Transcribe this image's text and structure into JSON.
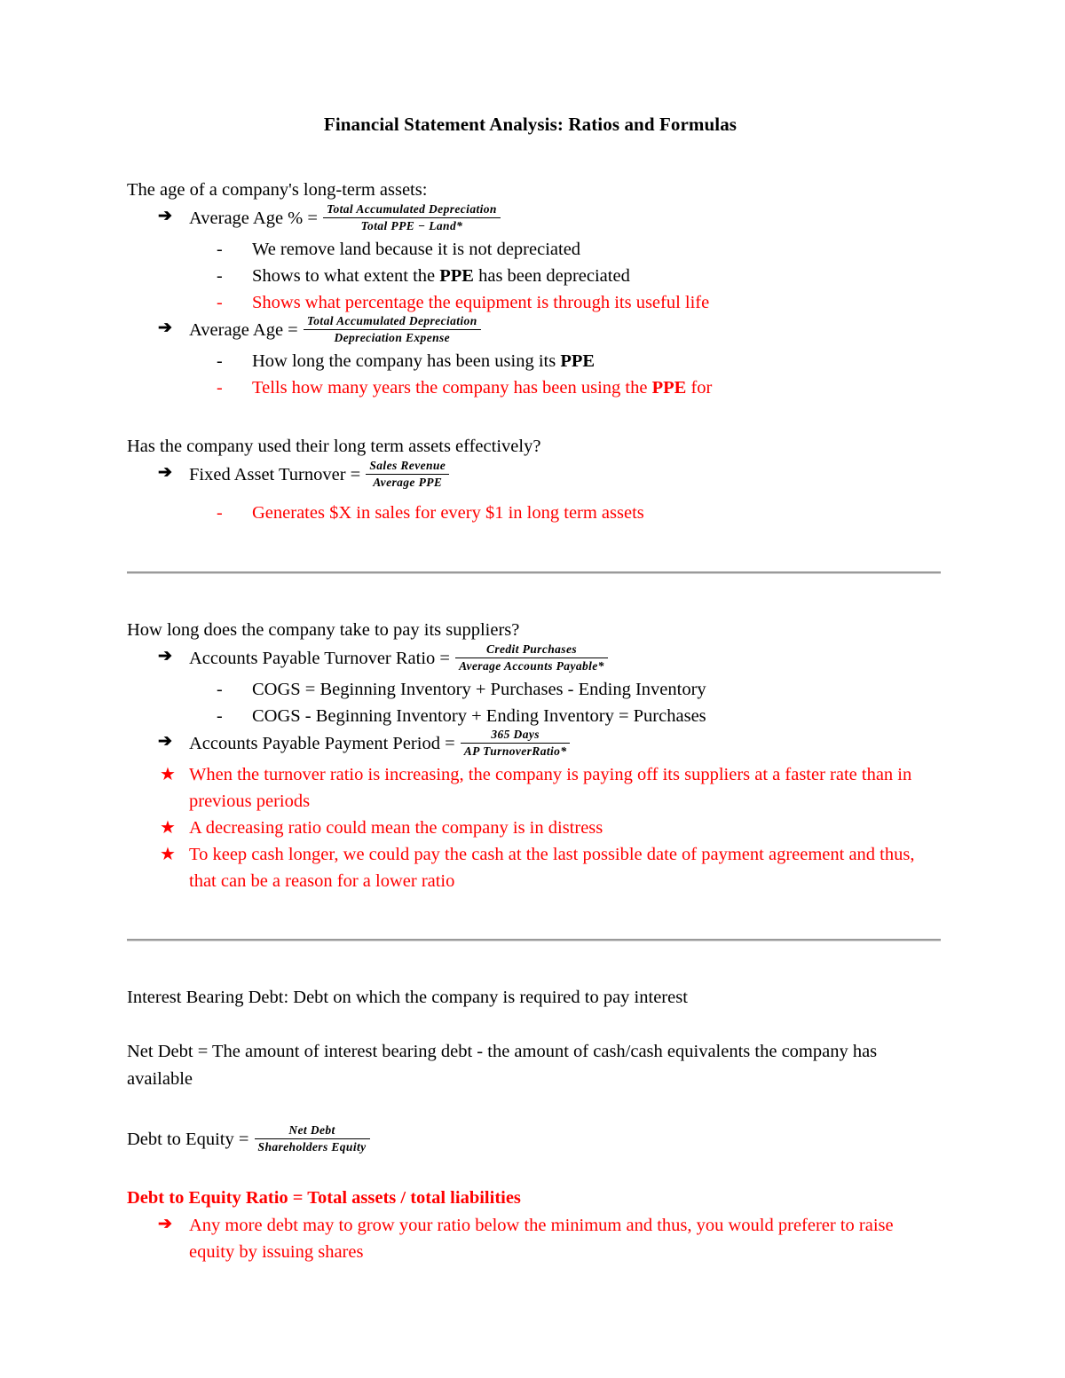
{
  "document": {
    "title": "Financial Statement Analysis: Ratios and Formulas"
  },
  "sections": {
    "asset_age": {
      "heading": "The age of a company's long-term assets:",
      "avg_age_pct": {
        "label": "Average Age % =",
        "numerator": "Total Accumulated Depreciation",
        "denominator": "Total PPE − Land*"
      },
      "avg_age_pct_notes": [
        "We remove land because it is not depreciated",
        "Shows to what extent the PPE has been depreciated",
        "Shows what percentage the equipment is through its useful life"
      ],
      "avg_age": {
        "label": "Average Age  =",
        "numerator": "Total Accumulated Depreciation",
        "denominator": "Depreciation Expense"
      },
      "avg_age_notes": [
        "How long the company has been using its PPE",
        "Tells how many years the company has been using the PPE for"
      ]
    },
    "asset_efficiency": {
      "heading": "Has the company used their long term assets effectively?",
      "fixed_asset_turnover": {
        "label": "Fixed Asset Turnover  =",
        "numerator": "Sales Revenue",
        "denominator": "Average PPE"
      },
      "note": "Generates $X in sales for every $1 in long term assets"
    },
    "accounts_payable": {
      "heading": "How long does the company take to pay its suppliers?",
      "ap_turnover_ratio": {
        "label": "Accounts Payable Turnover Ratio =",
        "numerator": "Credit Purchases",
        "denominator": "Average Accounts Payable*"
      },
      "cogs_notes": [
        "COGS = Beginning Inventory + Purchases - Ending Inventory",
        "COGS - Beginning Inventory + Ending Inventory = Purchases"
      ],
      "ap_payment_period": {
        "label": "Accounts Payable Payment Period =",
        "numerator": "365 Days",
        "denominator": "AP TurnoverRatio*"
      },
      "star_notes": [
        "When the turnover ratio is increasing, the company is paying off its suppliers at a faster rate than in previous periods",
        "A decreasing ratio could mean the company is in distress",
        "To keep cash longer, we could pay the cash at the last possible date of payment agreement and thus, that can be a reason for a lower ratio"
      ]
    },
    "debt": {
      "interest_bearing_debt": "Interest Bearing Debt: Debt on which the company is required to pay interest",
      "net_debt": "Net Debt =  The amount of interest bearing debt - the amount of cash/cash equivalents  the company has available",
      "debt_to_equity": {
        "label": "Debt to Equity  =",
        "numerator": "Net Debt",
        "denominator": "Shareholders Equity"
      },
      "debt_to_equity_ratio_heading": "Debt to Equity Ratio = Total assets / total liabilities",
      "debt_to_equity_note": "Any more debt may to grow your ratio below the minimum and thus, you would preferer to raise equity by issuing shares"
    }
  },
  "glyphs": {
    "arrow": "➔",
    "dash": "-",
    "star": "★"
  },
  "colors": {
    "text": "#000000",
    "highlight": "#FF0000",
    "rule": "#9a9a9a"
  }
}
